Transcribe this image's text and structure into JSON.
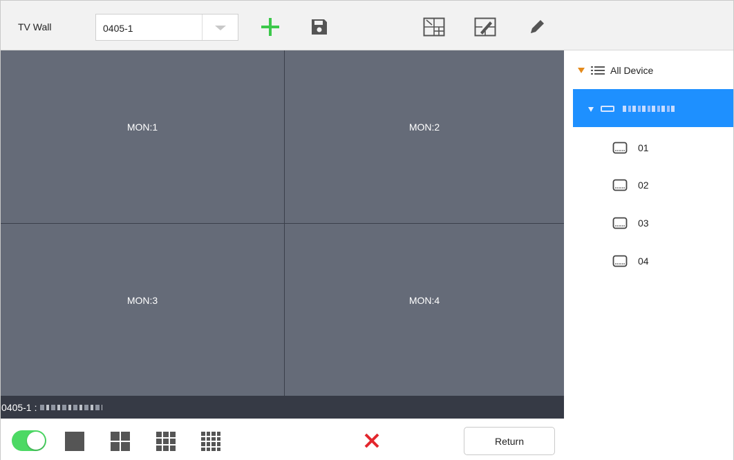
{
  "toolbar": {
    "title": "TV Wall",
    "wall_select": {
      "value": "0405-1"
    },
    "icons": {
      "add": "plus-icon",
      "save": "floppy-disk-icon",
      "layout_edit": "grid-split-icon",
      "layout_merge": "grid-merge-icon",
      "edit": "pencil-icon"
    },
    "colors": {
      "add": "#3cc84b",
      "icon": "#555555"
    }
  },
  "wall": {
    "monitors": [
      {
        "label": "MON:1"
      },
      {
        "label": "MON:2"
      },
      {
        "label": "MON:3"
      },
      {
        "label": "MON:4"
      }
    ],
    "background": "#646a77"
  },
  "status": {
    "wall_name": "0405-1",
    "separator": ":"
  },
  "bottom_bar": {
    "sync_toggle_on": true,
    "toggle_color": "#4cd964",
    "split_modes": [
      "1",
      "4",
      "9",
      "16"
    ],
    "clear_icon": "red-x-icon",
    "clear_color": "#e3262d",
    "return_label": "Return"
  },
  "device_tree": {
    "root": {
      "label": "All Device",
      "icon": "list-icon",
      "expanded": true
    },
    "device": {
      "selected": true,
      "icon": "device-icon",
      "expanded": true
    },
    "channels": [
      {
        "label": "01",
        "icon": "monitor-channel-icon"
      },
      {
        "label": "02",
        "icon": "monitor-channel-icon"
      },
      {
        "label": "03",
        "icon": "monitor-channel-icon"
      },
      {
        "label": "04",
        "icon": "monitor-channel-icon"
      }
    ],
    "accent": "#1e90ff",
    "arrow_color": "#e48a1c"
  }
}
